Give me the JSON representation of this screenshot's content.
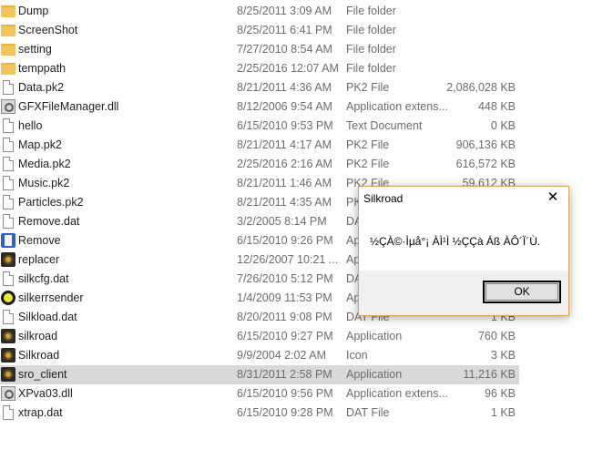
{
  "files": [
    {
      "name": "Dump",
      "date": "8/25/2011 3:09 AM",
      "type": "File folder",
      "size": "",
      "icon": "folder-icon"
    },
    {
      "name": "ScreenShot",
      "date": "8/25/2011 6:41 PM",
      "type": "File folder",
      "size": "",
      "icon": "folder-icon"
    },
    {
      "name": "setting",
      "date": "7/27/2010 8:54 AM",
      "type": "File folder",
      "size": "",
      "icon": "folder-icon"
    },
    {
      "name": "temppath",
      "date": "2/25/2016 12:07 AM",
      "type": "File folder",
      "size": "",
      "icon": "folder-icon"
    },
    {
      "name": "Data.pk2",
      "date": "8/21/2011 4:36 AM",
      "type": "PK2 File",
      "size": "2,086,028 KB",
      "icon": "file-icon"
    },
    {
      "name": "GFXFileManager.dll",
      "date": "8/12/2006 9:54 AM",
      "type": "Application extens...",
      "size": "448 KB",
      "icon": "gear-file-icon"
    },
    {
      "name": "hello",
      "date": "6/15/2010 9:53 PM",
      "type": "Text Document",
      "size": "0 KB",
      "icon": "file-icon"
    },
    {
      "name": "Map.pk2",
      "date": "8/21/2011 4:17 AM",
      "type": "PK2 File",
      "size": "906,136 KB",
      "icon": "file-icon"
    },
    {
      "name": "Media.pk2",
      "date": "2/25/2016 2:16 AM",
      "type": "PK2 File",
      "size": "616,572 KB",
      "icon": "file-icon"
    },
    {
      "name": "Music.pk2",
      "date": "8/21/2011 1:46 AM",
      "type": "PK2 File",
      "size": "59,612 KB",
      "icon": "file-icon"
    },
    {
      "name": "Particles.pk2",
      "date": "8/21/2011 4:35 AM",
      "type": "PK2 File",
      "size": "",
      "icon": "file-icon"
    },
    {
      "name": "Remove.dat",
      "date": "3/2/2005 8:14 PM",
      "type": "DAT File",
      "size": "",
      "icon": "file-icon"
    },
    {
      "name": "Remove",
      "date": "6/15/2010 9:26 PM",
      "type": "Application",
      "size": "",
      "icon": "remove-app-icon"
    },
    {
      "name": "replacer",
      "date": "12/26/2007 10:21 ...",
      "type": "Application",
      "size": "",
      "icon": "app-icon"
    },
    {
      "name": "silkcfg.dat",
      "date": "7/26/2010 5:12 PM",
      "type": "DAT File",
      "size": "",
      "icon": "file-icon"
    },
    {
      "name": "silkerrsender",
      "date": "1/4/2009 11:53 PM",
      "type": "Application",
      "size": "",
      "icon": "yellow-circle-icon"
    },
    {
      "name": "Silkload.dat",
      "date": "8/20/2011 9:08 PM",
      "type": "DAT File",
      "size": "1 KB",
      "icon": "file-icon"
    },
    {
      "name": "silkroad",
      "date": "6/15/2010 9:27 PM",
      "type": "Application",
      "size": "760 KB",
      "icon": "app-icon"
    },
    {
      "name": "Silkroad",
      "date": "9/9/2004 2:02 AM",
      "type": "Icon",
      "size": "3 KB",
      "icon": "app-icon"
    },
    {
      "name": "sro_client",
      "date": "8/31/2011 2:58 PM",
      "type": "Application",
      "size": "11,216 KB",
      "icon": "app-icon",
      "selected": true
    },
    {
      "name": "XPva03.dll",
      "date": "6/15/2010 9:56 PM",
      "type": "Application extens...",
      "size": "96 KB",
      "icon": "gear-file-icon"
    },
    {
      "name": "xtrap.dat",
      "date": "6/15/2010 9:28 PM",
      "type": "DAT File",
      "size": "1 KB",
      "icon": "file-icon"
    }
  ],
  "dialog": {
    "title": "Silkroad",
    "close_label": "✕",
    "message": "½ÇÀ©·Ìµå°¡ ÀÌ¹Ì ½ÇÇà Áß ÀÔ´Ï´Ù.",
    "ok_label": "OK",
    "border_color": "#d9a35a"
  },
  "colors": {
    "selected_row": "#d9d9d9",
    "folder": "#f2c55c"
  }
}
